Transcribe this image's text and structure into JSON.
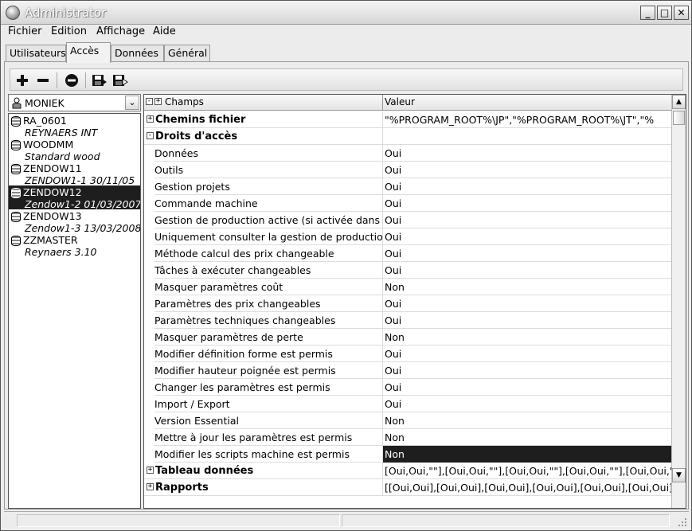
{
  "window": {
    "title": "Administrator"
  },
  "menu": [
    "Fichier",
    "Edition",
    "Affichage",
    "Aide"
  ],
  "tabs": [
    {
      "label": "Utilisateurs",
      "active": false
    },
    {
      "label": "Accès",
      "active": true
    },
    {
      "label": "Données",
      "active": false
    },
    {
      "label": "Général",
      "active": false
    }
  ],
  "toolbar": {
    "buttons": [
      "plus-icon",
      "minus-icon",
      "delete-circle-icon",
      "save-icon",
      "save-as-icon"
    ]
  },
  "user_combo": {
    "value": "MONIEK"
  },
  "databases": [
    {
      "name": "RA_0601",
      "sub": "REYNAERS INT",
      "selected": false
    },
    {
      "name": "WOODMM",
      "sub": "Standard wood",
      "selected": false
    },
    {
      "name": "ZENDOW11",
      "sub": "ZENDOW1-1 30/11/05",
      "selected": false
    },
    {
      "name": "ZENDOW12",
      "sub": "Zendow1-2 01/03/2007",
      "selected": true
    },
    {
      "name": "ZENDOW13",
      "sub": "Zendow1-3 13/03/2008",
      "selected": false
    },
    {
      "name": "ZZMASTER",
      "sub": "Reynaers 3.10",
      "selected": false
    }
  ],
  "grid": {
    "headers": {
      "champs": "Champs",
      "valeur": "Valeur"
    },
    "rows": [
      {
        "field": "Chemins fichier",
        "value": "\"%PROGRAM_ROOT%\\JP\",\"%PROGRAM_ROOT%\\JT\",\"%",
        "type": "group",
        "expander": "+"
      },
      {
        "field": "Droits d'accès",
        "value": "",
        "type": "group",
        "expander": "-"
      },
      {
        "field": "Données",
        "value": "Oui",
        "type": "item"
      },
      {
        "field": "Outils",
        "value": "Oui",
        "type": "item"
      },
      {
        "field": "Gestion projets",
        "value": "Oui",
        "type": "item"
      },
      {
        "field": "Commande machine",
        "value": "Oui",
        "type": "item"
      },
      {
        "field": "Gestion de production active (si activée dans la",
        "value": "Oui",
        "type": "item"
      },
      {
        "field": "Uniquement consulter la gestion de production (s",
        "value": "Oui",
        "type": "item"
      },
      {
        "field": "Méthode calcul des prix changeable",
        "value": "Oui",
        "type": "item"
      },
      {
        "field": "Tâches à exécuter changeables",
        "value": "Oui",
        "type": "item"
      },
      {
        "field": "Masquer paramètres coût",
        "value": "Non",
        "type": "item"
      },
      {
        "field": "Paramètres des prix changeables",
        "value": "Oui",
        "type": "item"
      },
      {
        "field": "Paramètres techniques changeables",
        "value": "Oui",
        "type": "item"
      },
      {
        "field": "Masquer paramètres de perte",
        "value": "Non",
        "type": "item"
      },
      {
        "field": "Modifier définition forme est permis",
        "value": "Oui",
        "type": "item"
      },
      {
        "field": "Modifier hauteur poignée est permis",
        "value": "Oui",
        "type": "item"
      },
      {
        "field": "Changer les paramètres est permis",
        "value": "Oui",
        "type": "item"
      },
      {
        "field": "Import / Export",
        "value": "Oui",
        "type": "item"
      },
      {
        "field": "Version Essential",
        "value": "Non",
        "type": "item"
      },
      {
        "field": "Mettre à jour les paramètres est permis",
        "value": "Non",
        "type": "item"
      },
      {
        "field": "Modifier les scripts machine est permis",
        "value": "Non",
        "type": "item",
        "selected": true
      },
      {
        "field": "Tableau données",
        "value": "[Oui,Oui,\"\"],[Oui,Oui,\"\"],[Oui,Oui,\"\"],[Oui,Oui,\"\"],[Oui,Oui,\"\"],[O",
        "type": "group",
        "expander": "+"
      },
      {
        "field": "Rapports",
        "value": "[[Oui,Oui],[Oui,Oui],[Oui,Oui],[Oui,Oui],[Oui,Oui],[Oui,Oui],[Oui,O",
        "type": "group",
        "expander": "+"
      }
    ]
  }
}
